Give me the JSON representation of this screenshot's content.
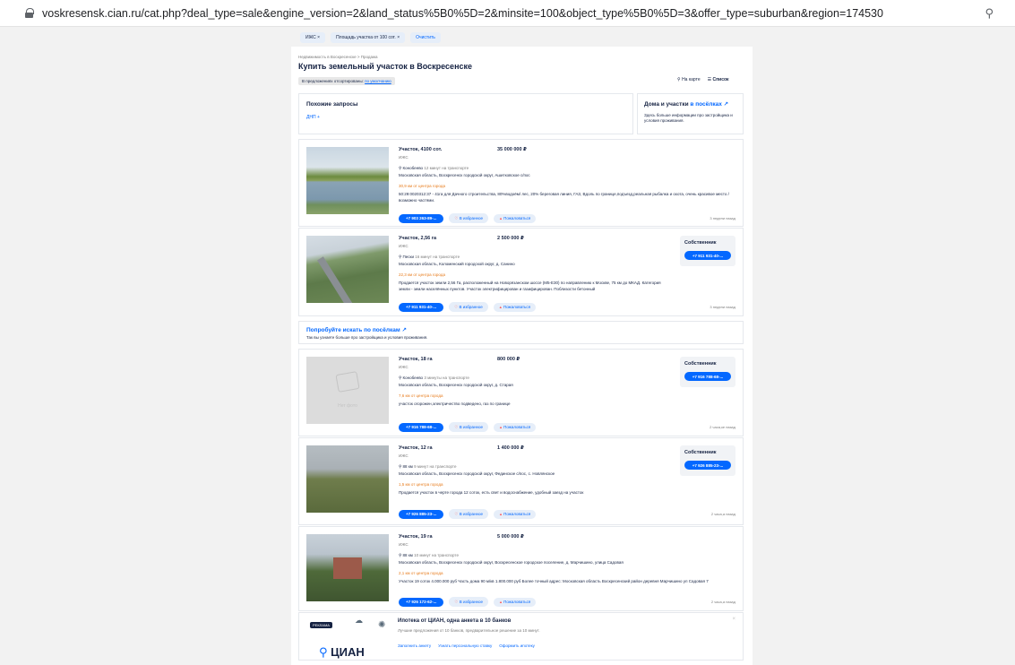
{
  "browser": {
    "url_host": "voskresensk.cian.ru",
    "url_path": "/cat.php?deal_type=sale&engine_version=2&land_status%5B0%5D=2&minsite=100&object_type%5B0%5D=3&offer_type=suburban&region=174530",
    "zoom_icon": "zoom-icon"
  },
  "filters": {
    "chips": [
      "ИЖС",
      "Площадь участка от 100 сот."
    ],
    "clear_label": "Очистить"
  },
  "breadcrumbs": "Недвижимость в Воскресенске > Продажа",
  "page_title": "Купить земельный участок в Воскресенске",
  "sort": {
    "prefix": "В предложениях отсортированы:",
    "value": "по умолчанию"
  },
  "view": {
    "map_label": "На карте",
    "list_label": "Список"
  },
  "similar": {
    "title": "Похожие запросы",
    "link": "ДНП"
  },
  "houses": {
    "title_prefix": "Дома и участки",
    "title_link": "в посёлках ↗",
    "desc": "Здесь больше информации про застройщика и условия проживания."
  },
  "listings": [
    {
      "title": "Участок, 4100 сот.",
      "price": "35 000 000 ₽",
      "sub": "ИЖС",
      "station": "Конобеево",
      "transit": "12 минут на транспорте",
      "address": "Московская область, Воскресенск городской округ, Ашитковское с/пос",
      "distance": "30,9 км от центра города",
      "desc": "50:29:0020312:37 - 41га для Дачного строительства, 80%водоём/ лес, 20% береговая линия, ГАЗ, Вдоль по границе,подъезд,реальная рыбалка и охота, очень красивое место / возможно частями.",
      "phone": "+7 903 263-89-...",
      "fav": "В избранное",
      "report": "Пожаловаться",
      "time": "3 недели назад",
      "owner_title": "",
      "owner_phone": ""
    },
    {
      "title": "Участок, 2,56 га",
      "price": "2 500 000 ₽",
      "sub": "ИЖС",
      "station": "Пески",
      "transit": "16 минут на транспорте",
      "address": "Московская область, Коломенский городской округ, д. Санино",
      "distance": "22,3 км от центра города",
      "desc": "Продается участок земли 2,56 Га, расположенный на Новорязанском шоссе (М5-E30) по направлению к Москве, 75 км до МКАД. Категория земли - земли населённых пунктов. Участок электрифицирован и газифицирован. Поблизости бетонный",
      "phone": "+7 911 931-40-...",
      "fav": "В избранное",
      "report": "Пожаловаться",
      "time": "3 недели назад",
      "owner_title": "Собственник",
      "owner_phone": "+7 911 931-40-..."
    },
    {
      "title": "Участок, 18 га",
      "price": "800 000 ₽",
      "sub": "ИЖС",
      "station": "Конобеево",
      "transit": "3 минуты на транспорте",
      "address": "Московская область, Воскресенск городской округ, д. Старая",
      "distance": "7,6 км от центра города",
      "desc": "участок огорожен,электричество подведено, газ по границе",
      "phone": "+7 916 788-68-...",
      "fav": "В избранное",
      "report": "Пожаловаться",
      "time": "2 часа,ке назад",
      "owner_title": "Собственник",
      "owner_phone": "+7 916 788-68-...",
      "nophoto": "Нет фото"
    },
    {
      "title": "Участок, 12 га",
      "price": "1 400 000 ₽",
      "sub": "ИЖС",
      "station": "88 км",
      "transit": "9 минут на транспорте",
      "address": "Московская область, Воскресенск городской округ, Фединское с/пос, с. Новлянское",
      "distance": "1,5 км от центра города",
      "desc": "Продается участок в черте города 12 соток, есть свет и водоснабжение, удобный заезд на участок",
      "phone": "+7 926 885-23-...",
      "fav": "В избранное",
      "report": "Пожаловаться",
      "time": "2 часа,а назад",
      "owner_title": "Собственник",
      "owner_phone": "+7 926 885-23-..."
    },
    {
      "title": "Участок, 19 га",
      "price": "5 000 000 ₽",
      "sub": "ИЖС",
      "station": "88 км",
      "transit": "10 минут на транспорте",
      "address": "Московская область, Воскресенск городской округ, Воскресенское городское поселение, д. Марчишино, улица Садовая",
      "distance": "2,1 км от центра города",
      "desc": "Участок 19 соток 4.000.000 руб Часть дома 90 м/кв 1.800.000 руб Более точный адрес: Московская область Воскресенский район деревня Марчишино ул Садовая 7",
      "phone": "+7 926 172-62-...",
      "fav": "В избранное",
      "report": "Пожаловаться",
      "time": "2 часа,а назад",
      "owner_title": "",
      "owner_phone": ""
    }
  ],
  "try_village": {
    "title_prefix": "Попробуйте искать",
    "title_link": "по посёлкам ↗",
    "desc": "Так вы узнаете больше про застройщика и условия проживания."
  },
  "mortgage": {
    "ad_label": "РЕКЛАМА",
    "logo": "ЦИАН",
    "title": "Ипотека от ЦИАН, одна анкета в 10 банков",
    "desc": "Лучшие предложения от 10 банков, предварительное решение за 10 минут.",
    "links": [
      "Заполнить анкету",
      "Узнать персональную ставку",
      "Оформить ипотеку"
    ],
    "close": "×"
  },
  "colors": {
    "accent": "#0468ff",
    "text": "#152242",
    "distance": "#e77b1b",
    "background": "#f2f2f2"
  }
}
